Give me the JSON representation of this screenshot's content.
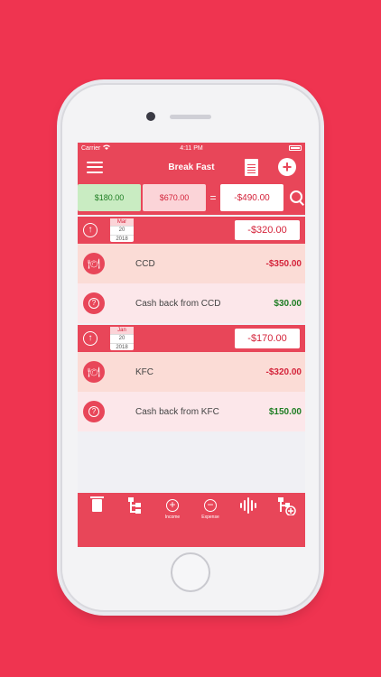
{
  "status_bar": {
    "carrier": "Carrier",
    "time": "4:11 PM"
  },
  "nav": {
    "title": "Break Fast"
  },
  "summary": {
    "income": "$180.00",
    "expense": "$670.00",
    "equals": "=",
    "balance": "-$490.00"
  },
  "groups": [
    {
      "month": "Mar",
      "day": "20",
      "year": "2018",
      "total": "-$320.00",
      "transactions": [
        {
          "name": "CCD",
          "amount": "-$350.00",
          "kind": "expense",
          "icon": "restaurant-icon"
        },
        {
          "name": "Cash back from CCD",
          "amount": "$30.00",
          "kind": "income",
          "icon": "question-icon"
        }
      ]
    },
    {
      "month": "Jan",
      "day": "20",
      "year": "2018",
      "total": "-$170.00",
      "transactions": [
        {
          "name": "KFC",
          "amount": "-$320.00",
          "kind": "expense",
          "icon": "restaurant-icon"
        },
        {
          "name": "Cash back from KFC",
          "amount": "$150.00",
          "kind": "income",
          "icon": "question-icon"
        }
      ]
    }
  ],
  "toolbar": {
    "income_label": "Income",
    "expense_label": "Expense"
  },
  "colors": {
    "brand": "#e84659",
    "income_green": "#1e7d23",
    "expense_red": "#d4233a"
  }
}
